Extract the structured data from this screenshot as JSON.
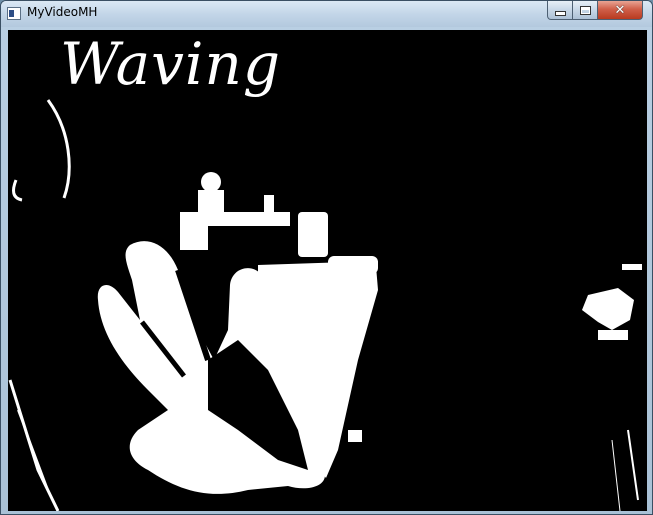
{
  "window": {
    "title": "MyVideoMH"
  },
  "controls": {
    "minimize_icon": "minimize-icon",
    "maximize_icon": "maximize-icon",
    "close_icon": "close-icon",
    "close_glyph": "✕"
  },
  "video": {
    "gesture_label": "Waving"
  },
  "colors": {
    "foreground": "#ffffff",
    "background": "#000000",
    "close_red": "#c8452c"
  }
}
